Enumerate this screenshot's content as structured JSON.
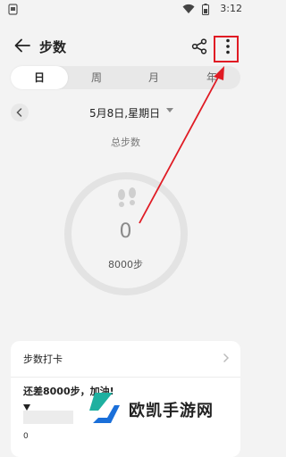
{
  "status_bar": {
    "time": "3:12",
    "icons": [
      "app-notification-icon",
      "wifi-icon",
      "battery-icon"
    ]
  },
  "header": {
    "title": "步数",
    "back_icon": "back-arrow-icon",
    "share_icon": "share-icon",
    "more_icon": "more-vertical-icon"
  },
  "tabs": [
    {
      "label": "日",
      "active": true
    },
    {
      "label": "周",
      "active": false
    },
    {
      "label": "月",
      "active": false
    },
    {
      "label": "年",
      "active": false
    }
  ],
  "date_bar": {
    "date": "5月8日,星期日"
  },
  "summary": {
    "label": "总步数",
    "steps": "0",
    "goal": "8000步",
    "progress": 0
  },
  "card": {
    "title": "步数打卡",
    "message": "还差8000步，加油!",
    "axis_start": "0"
  },
  "watermark": {
    "text": "欧凯手游网"
  },
  "colors": {
    "accent": "#4c9aff",
    "annotation": "#e01b24",
    "watermark": "#1fb0a0"
  }
}
